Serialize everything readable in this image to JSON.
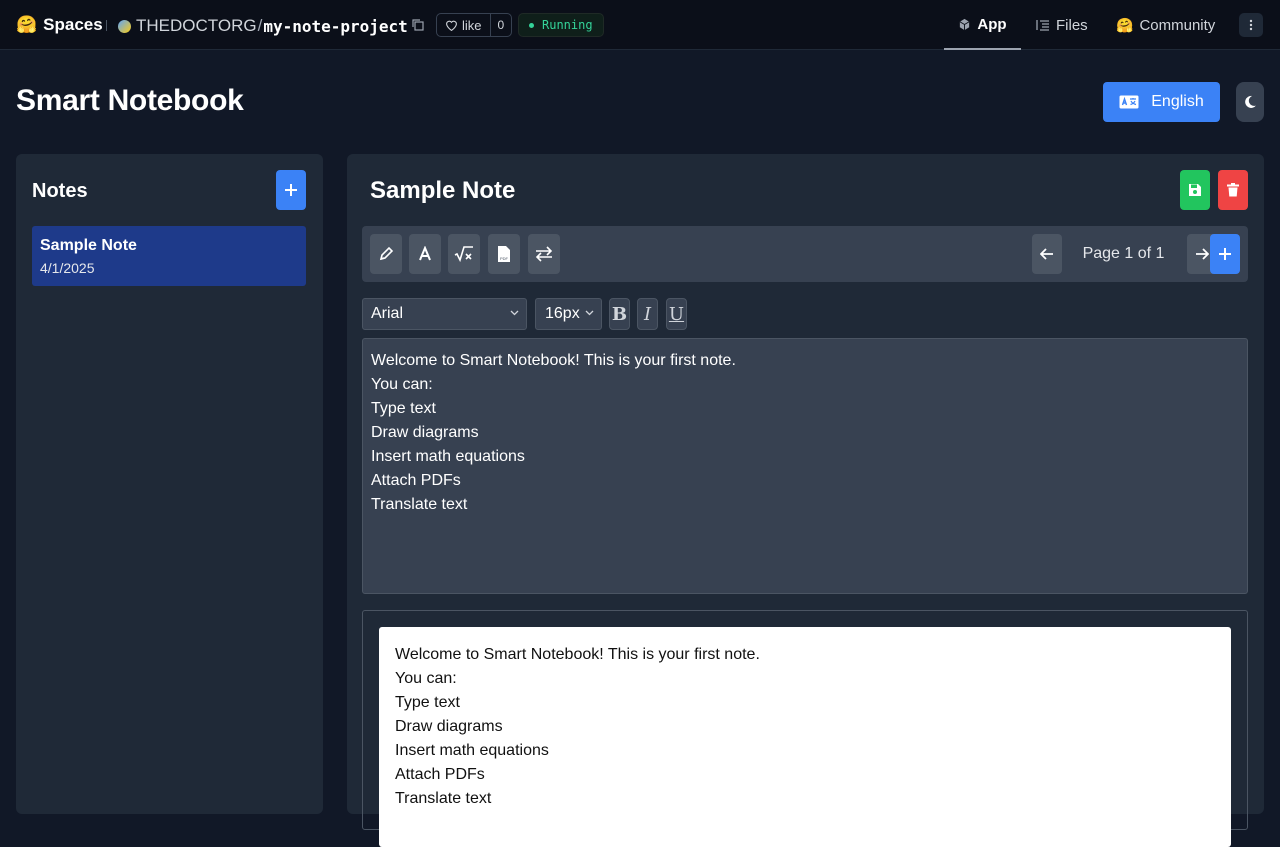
{
  "topbar": {
    "spaces_label": "Spaces",
    "org": "THEDOCTORG",
    "repo_name": "my-note-project",
    "like_label": "like",
    "like_count": "0",
    "status": "Running",
    "nav": {
      "app": "App",
      "files": "Files",
      "community": "Community"
    }
  },
  "header": {
    "title": "Smart Notebook",
    "language_button": "English"
  },
  "sidebar": {
    "title": "Notes",
    "notes": [
      {
        "title": "Sample Note",
        "date": "4/1/2025"
      }
    ]
  },
  "note": {
    "title": "Sample Note",
    "page_label": "Page 1 of 1",
    "font": "Arial",
    "font_size": "16px",
    "format_buttons": {
      "bold": "B",
      "italic": "I",
      "underline": "U"
    },
    "content_lines": [
      "Welcome to Smart Notebook! This is your first note.",
      "You can:",
      "Type text",
      "Draw diagrams",
      "Insert math equations",
      "Attach PDFs",
      "Translate text"
    ]
  },
  "icons": {
    "logo": "hugging-face-emoji",
    "copy": "copy-icon",
    "heart": "heart-icon",
    "app": "cube-icon",
    "files": "files-icon",
    "community": "community-icon",
    "menu": "kebab-menu-icon",
    "language": "translate-icon",
    "theme": "moon-icon",
    "add": "plus-icon",
    "save": "floppy-disk-icon",
    "delete": "trash-icon",
    "draw": "pencil-icon",
    "text": "text-icon",
    "math": "square-root-icon",
    "pdf": "pdf-file-icon",
    "translate": "swap-arrows-icon",
    "prev": "arrow-left-icon",
    "next": "arrow-right-icon"
  },
  "colors": {
    "accent": "#3b82f6",
    "save": "#22c55e",
    "delete": "#ef4444",
    "running": "#34d399",
    "active_note": "#1e3a8a"
  }
}
